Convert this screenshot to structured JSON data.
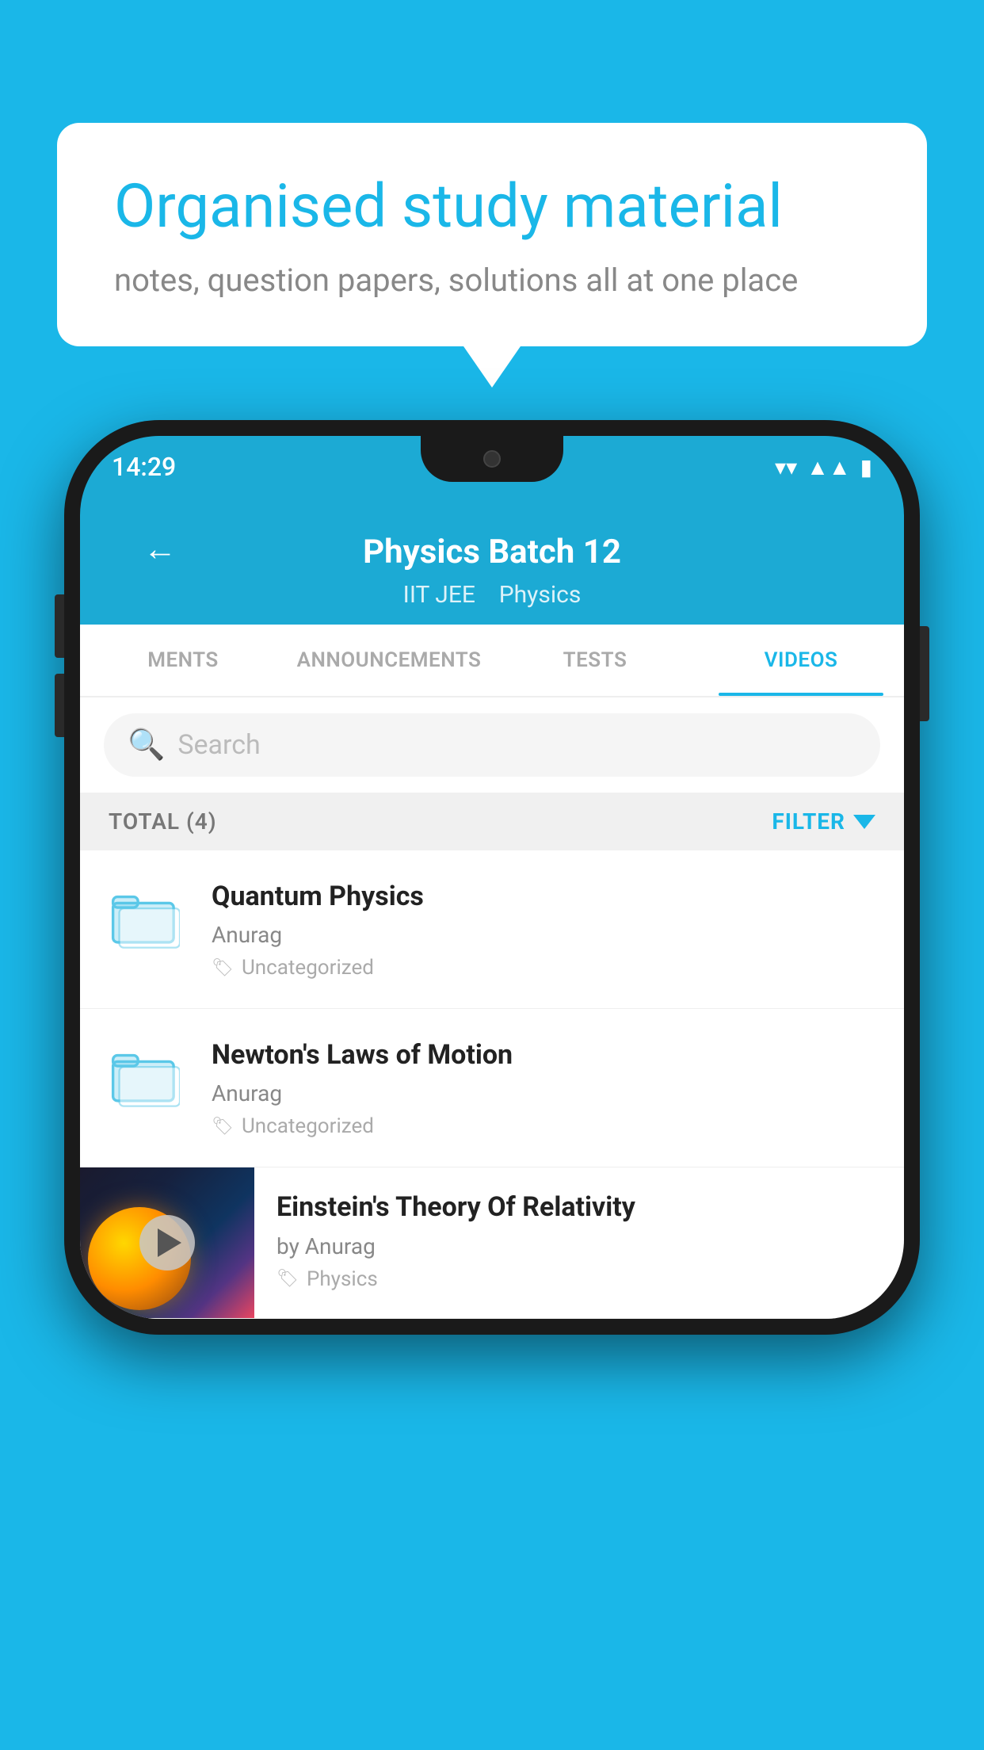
{
  "bubble": {
    "title": "Organised study material",
    "subtitle": "notes, question papers, solutions all at one place"
  },
  "statusBar": {
    "time": "14:29"
  },
  "appHeader": {
    "title": "Physics Batch 12",
    "subtitle1": "IIT JEE",
    "subtitle2": "Physics"
  },
  "tabs": [
    {
      "label": "MENTS",
      "active": false
    },
    {
      "label": "ANNOUNCEMENTS",
      "active": false
    },
    {
      "label": "TESTS",
      "active": false
    },
    {
      "label": "VIDEOS",
      "active": true
    }
  ],
  "search": {
    "placeholder": "Search"
  },
  "filterBar": {
    "total": "TOTAL (4)",
    "filterLabel": "FILTER"
  },
  "videos": [
    {
      "id": 1,
      "title": "Quantum Physics",
      "author": "Anurag",
      "tag": "Uncategorized",
      "type": "folder"
    },
    {
      "id": 2,
      "title": "Newton's Laws of Motion",
      "author": "Anurag",
      "tag": "Uncategorized",
      "type": "folder"
    },
    {
      "id": 3,
      "title": "Einstein's Theory Of Relativity",
      "author": "by Anurag",
      "tag": "Physics",
      "type": "video"
    }
  ]
}
